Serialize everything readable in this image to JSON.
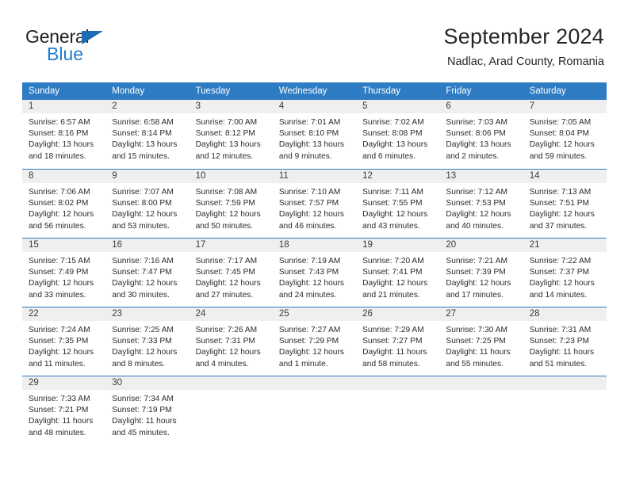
{
  "brand": {
    "name_part1": "General",
    "name_part2": "Blue",
    "triangle_icon": "blue-triangle-icon",
    "colors": {
      "dark": "#231f20",
      "blue": "#1f7dcf",
      "triangle": "#1b6cb5"
    }
  },
  "header": {
    "title": "September 2024",
    "subtitle": "Nadlac, Arad County, Romania"
  },
  "theme": {
    "header_bg": "#2e7cc4",
    "header_text": "#ffffff",
    "date_band_bg": "#efefef",
    "week_border": "#2e7cc4",
    "body_text": "#2b2b2b"
  },
  "weekdays": [
    "Sunday",
    "Monday",
    "Tuesday",
    "Wednesday",
    "Thursday",
    "Friday",
    "Saturday"
  ],
  "weeks": [
    {
      "days": [
        {
          "date": "1",
          "sunrise": "Sunrise: 6:57 AM",
          "sunset": "Sunset: 8:16 PM",
          "daylight1": "Daylight: 13 hours",
          "daylight2": "and 18 minutes."
        },
        {
          "date": "2",
          "sunrise": "Sunrise: 6:58 AM",
          "sunset": "Sunset: 8:14 PM",
          "daylight1": "Daylight: 13 hours",
          "daylight2": "and 15 minutes."
        },
        {
          "date": "3",
          "sunrise": "Sunrise: 7:00 AM",
          "sunset": "Sunset: 8:12 PM",
          "daylight1": "Daylight: 13 hours",
          "daylight2": "and 12 minutes."
        },
        {
          "date": "4",
          "sunrise": "Sunrise: 7:01 AM",
          "sunset": "Sunset: 8:10 PM",
          "daylight1": "Daylight: 13 hours",
          "daylight2": "and 9 minutes."
        },
        {
          "date": "5",
          "sunrise": "Sunrise: 7:02 AM",
          "sunset": "Sunset: 8:08 PM",
          "daylight1": "Daylight: 13 hours",
          "daylight2": "and 6 minutes."
        },
        {
          "date": "6",
          "sunrise": "Sunrise: 7:03 AM",
          "sunset": "Sunset: 8:06 PM",
          "daylight1": "Daylight: 13 hours",
          "daylight2": "and 2 minutes."
        },
        {
          "date": "7",
          "sunrise": "Sunrise: 7:05 AM",
          "sunset": "Sunset: 8:04 PM",
          "daylight1": "Daylight: 12 hours",
          "daylight2": "and 59 minutes."
        }
      ]
    },
    {
      "days": [
        {
          "date": "8",
          "sunrise": "Sunrise: 7:06 AM",
          "sunset": "Sunset: 8:02 PM",
          "daylight1": "Daylight: 12 hours",
          "daylight2": "and 56 minutes."
        },
        {
          "date": "9",
          "sunrise": "Sunrise: 7:07 AM",
          "sunset": "Sunset: 8:00 PM",
          "daylight1": "Daylight: 12 hours",
          "daylight2": "and 53 minutes."
        },
        {
          "date": "10",
          "sunrise": "Sunrise: 7:08 AM",
          "sunset": "Sunset: 7:59 PM",
          "daylight1": "Daylight: 12 hours",
          "daylight2": "and 50 minutes."
        },
        {
          "date": "11",
          "sunrise": "Sunrise: 7:10 AM",
          "sunset": "Sunset: 7:57 PM",
          "daylight1": "Daylight: 12 hours",
          "daylight2": "and 46 minutes."
        },
        {
          "date": "12",
          "sunrise": "Sunrise: 7:11 AM",
          "sunset": "Sunset: 7:55 PM",
          "daylight1": "Daylight: 12 hours",
          "daylight2": "and 43 minutes."
        },
        {
          "date": "13",
          "sunrise": "Sunrise: 7:12 AM",
          "sunset": "Sunset: 7:53 PM",
          "daylight1": "Daylight: 12 hours",
          "daylight2": "and 40 minutes."
        },
        {
          "date": "14",
          "sunrise": "Sunrise: 7:13 AM",
          "sunset": "Sunset: 7:51 PM",
          "daylight1": "Daylight: 12 hours",
          "daylight2": "and 37 minutes."
        }
      ]
    },
    {
      "days": [
        {
          "date": "15",
          "sunrise": "Sunrise: 7:15 AM",
          "sunset": "Sunset: 7:49 PM",
          "daylight1": "Daylight: 12 hours",
          "daylight2": "and 33 minutes."
        },
        {
          "date": "16",
          "sunrise": "Sunrise: 7:16 AM",
          "sunset": "Sunset: 7:47 PM",
          "daylight1": "Daylight: 12 hours",
          "daylight2": "and 30 minutes."
        },
        {
          "date": "17",
          "sunrise": "Sunrise: 7:17 AM",
          "sunset": "Sunset: 7:45 PM",
          "daylight1": "Daylight: 12 hours",
          "daylight2": "and 27 minutes."
        },
        {
          "date": "18",
          "sunrise": "Sunrise: 7:19 AM",
          "sunset": "Sunset: 7:43 PM",
          "daylight1": "Daylight: 12 hours",
          "daylight2": "and 24 minutes."
        },
        {
          "date": "19",
          "sunrise": "Sunrise: 7:20 AM",
          "sunset": "Sunset: 7:41 PM",
          "daylight1": "Daylight: 12 hours",
          "daylight2": "and 21 minutes."
        },
        {
          "date": "20",
          "sunrise": "Sunrise: 7:21 AM",
          "sunset": "Sunset: 7:39 PM",
          "daylight1": "Daylight: 12 hours",
          "daylight2": "and 17 minutes."
        },
        {
          "date": "21",
          "sunrise": "Sunrise: 7:22 AM",
          "sunset": "Sunset: 7:37 PM",
          "daylight1": "Daylight: 12 hours",
          "daylight2": "and 14 minutes."
        }
      ]
    },
    {
      "days": [
        {
          "date": "22",
          "sunrise": "Sunrise: 7:24 AM",
          "sunset": "Sunset: 7:35 PM",
          "daylight1": "Daylight: 12 hours",
          "daylight2": "and 11 minutes."
        },
        {
          "date": "23",
          "sunrise": "Sunrise: 7:25 AM",
          "sunset": "Sunset: 7:33 PM",
          "daylight1": "Daylight: 12 hours",
          "daylight2": "and 8 minutes."
        },
        {
          "date": "24",
          "sunrise": "Sunrise: 7:26 AM",
          "sunset": "Sunset: 7:31 PM",
          "daylight1": "Daylight: 12 hours",
          "daylight2": "and 4 minutes."
        },
        {
          "date": "25",
          "sunrise": "Sunrise: 7:27 AM",
          "sunset": "Sunset: 7:29 PM",
          "daylight1": "Daylight: 12 hours",
          "daylight2": "and 1 minute."
        },
        {
          "date": "26",
          "sunrise": "Sunrise: 7:29 AM",
          "sunset": "Sunset: 7:27 PM",
          "daylight1": "Daylight: 11 hours",
          "daylight2": "and 58 minutes."
        },
        {
          "date": "27",
          "sunrise": "Sunrise: 7:30 AM",
          "sunset": "Sunset: 7:25 PM",
          "daylight1": "Daylight: 11 hours",
          "daylight2": "and 55 minutes."
        },
        {
          "date": "28",
          "sunrise": "Sunrise: 7:31 AM",
          "sunset": "Sunset: 7:23 PM",
          "daylight1": "Daylight: 11 hours",
          "daylight2": "and 51 minutes."
        }
      ]
    },
    {
      "days": [
        {
          "date": "29",
          "sunrise": "Sunrise: 7:33 AM",
          "sunset": "Sunset: 7:21 PM",
          "daylight1": "Daylight: 11 hours",
          "daylight2": "and 48 minutes."
        },
        {
          "date": "30",
          "sunrise": "Sunrise: 7:34 AM",
          "sunset": "Sunset: 7:19 PM",
          "daylight1": "Daylight: 11 hours",
          "daylight2": "and 45 minutes."
        },
        {
          "date": "",
          "sunrise": "",
          "sunset": "",
          "daylight1": "",
          "daylight2": ""
        },
        {
          "date": "",
          "sunrise": "",
          "sunset": "",
          "daylight1": "",
          "daylight2": ""
        },
        {
          "date": "",
          "sunrise": "",
          "sunset": "",
          "daylight1": "",
          "daylight2": ""
        },
        {
          "date": "",
          "sunrise": "",
          "sunset": "",
          "daylight1": "",
          "daylight2": ""
        },
        {
          "date": "",
          "sunrise": "",
          "sunset": "",
          "daylight1": "",
          "daylight2": ""
        }
      ]
    }
  ]
}
